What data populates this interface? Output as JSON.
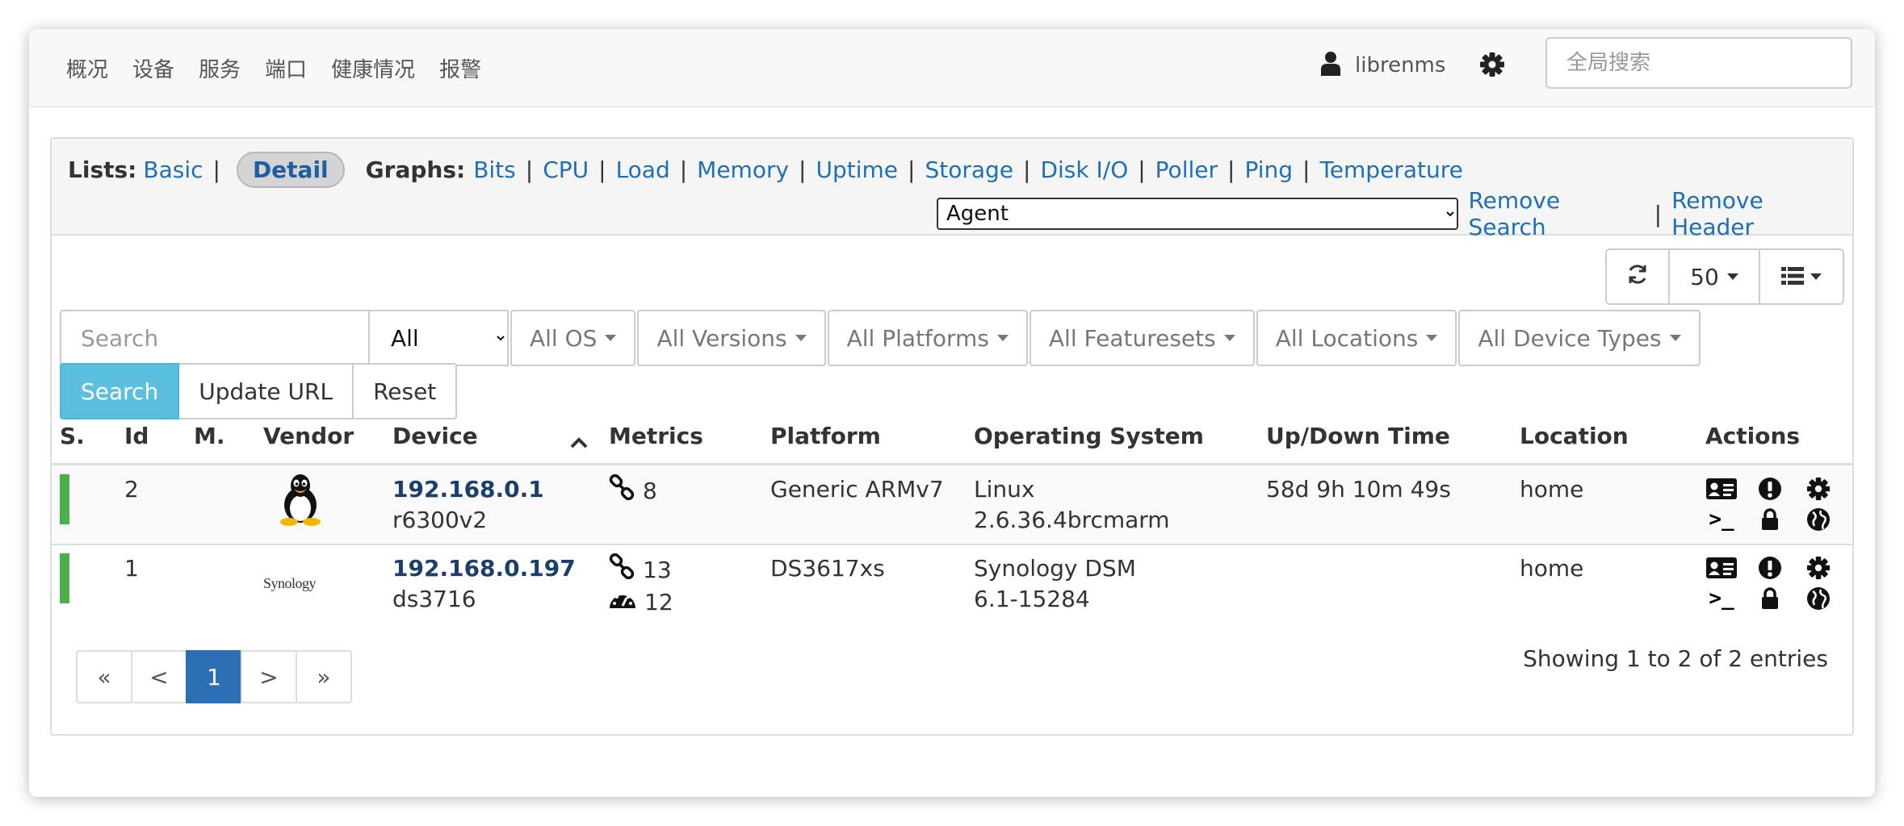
{
  "nav": {
    "items": [
      "概况",
      "设备",
      "服务",
      "端口",
      "健康情况",
      "报警"
    ],
    "username": "librenms",
    "search_placeholder": "全局搜索"
  },
  "lists": {
    "label": "Lists:",
    "basic": "Basic",
    "detail": "Detail",
    "graphs_label": "Graphs:",
    "graphs": [
      "Bits",
      "CPU",
      "Load",
      "Memory",
      "Uptime",
      "Storage",
      "Disk I/O",
      "Poller",
      "Ping",
      "Temperature"
    ],
    "agent_selected": "Agent",
    "remove_search": "Remove Search",
    "remove_header": "Remove Header"
  },
  "toolbar": {
    "page_size": "50"
  },
  "filters": {
    "search_placeholder": "Search",
    "status_selected": "All",
    "dropdowns": [
      "All OS",
      "All Versions",
      "All Platforms",
      "All Featuresets",
      "All Locations",
      "All Device Types"
    ],
    "search_button": "Search",
    "update_url_button": "Update URL",
    "reset_button": "Reset"
  },
  "table": {
    "headers": {
      "status": "S.",
      "id": "Id",
      "maint": "M.",
      "vendor": "Vendor",
      "device": "Device",
      "metrics": "Metrics",
      "platform": "Platform",
      "os": "Operating System",
      "uptime": "Up/Down Time",
      "location": "Location",
      "actions": "Actions"
    },
    "rows": [
      {
        "status_color": "#4cae4c",
        "id": "2",
        "vendor_icon": "linux-tux-icon",
        "hostname": "192.168.0.1",
        "sysname": "r6300v2",
        "ports": "8",
        "sensors": "",
        "platform": "Generic ARMv7",
        "os_name": "Linux",
        "os_version": "2.6.36.4brcmarm",
        "uptime": "58d 9h 10m 49s",
        "location": "home"
      },
      {
        "status_color": "#4cae4c",
        "id": "1",
        "vendor_logo_text": "Synology",
        "hostname": "192.168.0.197",
        "sysname": "ds3716",
        "ports": "13",
        "sensors": "12",
        "platform": "DS3617xs",
        "os_name": "Synology DSM",
        "os_version": "6.1-15284",
        "uptime": "",
        "location": "home"
      }
    ]
  },
  "pagination": {
    "first": "«",
    "prev": "<",
    "current": "1",
    "next": ">",
    "last": "»",
    "summary": "Showing 1 to 2 of 2 entries"
  }
}
